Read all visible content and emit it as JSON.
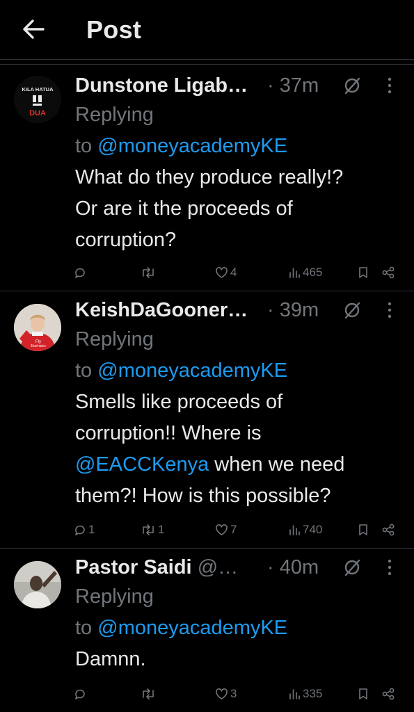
{
  "header": {
    "title": "Post",
    "back_icon": "arrow-left-icon"
  },
  "replies": [
    {
      "avatar_text_top": "KILA HATUA",
      "avatar_text_bottom": "DUA",
      "name": "Dunstone Ligab…",
      "handle": "",
      "time": "· 37m",
      "replying_prefix": "Replying",
      "replying_to": "to",
      "mention": "@moneyacademyKE",
      "body_lines": [
        "What do they produce really!?",
        "Or are it the proceeds of",
        "corruption?"
      ],
      "stats": {
        "replies": "",
        "reposts": "",
        "likes": "4",
        "views": "465"
      }
    },
    {
      "avatar_text_top": "Fly",
      "avatar_text_bottom": "Emirates",
      "name": "KeishDaGooner…",
      "handle": "",
      "time": "· 39m",
      "replying_prefix": "Replying",
      "replying_to": "to",
      "mention": "@moneyacademyKE",
      "body_lines": [
        "Smells like proceeds of",
        "corruption!! Where is"
      ],
      "body_mention": "@EACCKenya",
      "body_after_mention": " when we need",
      "body_last": "them?! How is this possible?",
      "stats": {
        "replies": "1",
        "reposts": "1",
        "likes": "7",
        "views": "740"
      }
    },
    {
      "name": "Pastor Saidi",
      "handle": "@…",
      "time": "· 40m",
      "replying_prefix": "Replying",
      "replying_to": "to",
      "mention": "@moneyacademyKE",
      "body_lines": [
        "Damnn."
      ],
      "stats": {
        "replies": "",
        "reposts": "",
        "likes": "3",
        "views": "335"
      }
    }
  ],
  "colors": {
    "background": "#000000",
    "text": "#e7e9ea",
    "muted": "#71767b",
    "link": "#1d9bf0",
    "divider": "#2f3336"
  }
}
